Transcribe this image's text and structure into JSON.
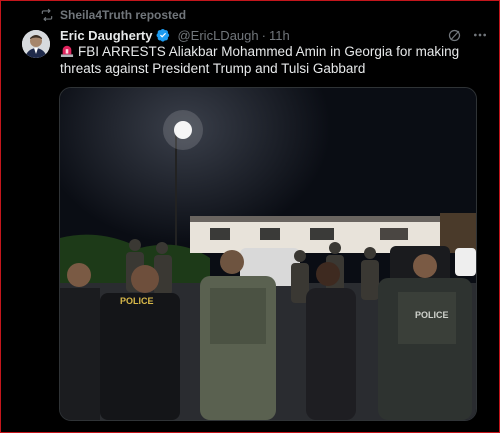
{
  "repost": {
    "label": "Sheila4Truth reposted",
    "icon": "repost-icon"
  },
  "post": {
    "author_name": "Eric Daugherty",
    "handle": "@EricLDaugh",
    "separator": "·",
    "time": "11h",
    "text": "FBI ARRESTS Aliakbar Mohammed Amin in Georgia for making threats against President Trump and Tulsi Gabbard",
    "lead_icon": "siren-icon"
  },
  "photo": {
    "vest_text_1": "POLICE",
    "vest_text_2": "POLICE"
  },
  "colors": {
    "border": "#c4161c",
    "verified": "#1d9bf0",
    "muted": "#71767b"
  }
}
